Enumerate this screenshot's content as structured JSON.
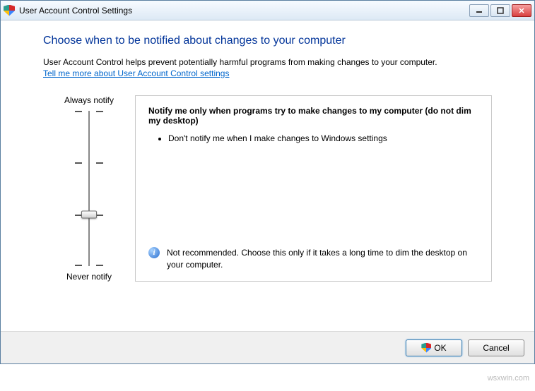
{
  "window": {
    "title": "User Account Control Settings"
  },
  "content": {
    "heading": "Choose when to be notified about changes to your computer",
    "description": "User Account Control helps prevent potentially harmful programs from making changes to your computer.",
    "link": "Tell me more about User Account Control settings"
  },
  "slider": {
    "top_label": "Always notify",
    "bottom_label": "Never notify",
    "levels": 4,
    "current_level": 1
  },
  "info": {
    "title": "Notify me only when programs try to make changes to my computer (do not dim my desktop)",
    "bullets": [
      "Don't notify me when I make changes to Windows settings"
    ],
    "footer": "Not recommended. Choose this only if it takes a long time to dim the desktop on your computer."
  },
  "buttons": {
    "ok": "OK",
    "cancel": "Cancel"
  },
  "watermark": "wsxwin.com"
}
